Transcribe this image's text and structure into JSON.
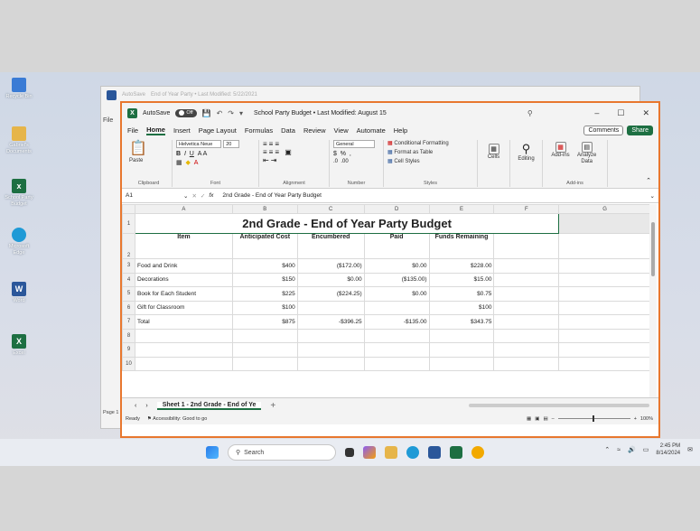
{
  "desktop_icons": [
    {
      "label": "Recycle Bin",
      "color": "#3a7bd5"
    },
    {
      "label": "Gabriel's Documents",
      "color": "#e6b54a"
    },
    {
      "label": "School Party Budget",
      "color": "#1d6f42"
    },
    {
      "label": "Microsoft Edge",
      "color": "#1f9ad6"
    },
    {
      "label": "Word",
      "color": "#2b579a"
    },
    {
      "label": "Excel",
      "color": "#1d6f42"
    }
  ],
  "back_window": {
    "title": "End of Year Party • Last Modified: 5/22/2021",
    "autosave": "AutoSave",
    "menu_file": "File",
    "page_label": "Page 1"
  },
  "window": {
    "autosave_label": "AutoSave",
    "autosave_state": "Off",
    "title": "School Party Budget • Last Modified: August 15"
  },
  "menu": {
    "items": [
      "File",
      "Home",
      "Insert",
      "Page Layout",
      "Formulas",
      "Data",
      "Review",
      "View",
      "Automate",
      "Help"
    ],
    "comments": "Comments",
    "share": "Share"
  },
  "ribbon": {
    "paste": "Paste",
    "clipboard": "Clipboard",
    "font_name": "Helvetica Neue",
    "font_size": "20",
    "font": "Font",
    "alignment": "Alignment",
    "number_format": "General",
    "number": "Number",
    "cond_format": "Conditional Formatting",
    "format_table": "Format as Table",
    "cell_styles": "Cell Styles",
    "styles": "Styles",
    "cells": "Cells",
    "editing": "Editing",
    "addins": "Add-ins",
    "analyze": "Analyze Data",
    "addins_group": "Add-ins"
  },
  "formula_bar": {
    "cell_ref": "A1",
    "fx": "fx",
    "content": "2nd Grade - End of Year Party Budget"
  },
  "columns": [
    "A",
    "B",
    "C",
    "D",
    "E",
    "F",
    "G"
  ],
  "sheet": {
    "title": "2nd Grade - End of Year Party Budget",
    "headers": [
      "Item",
      "Anticipated Cost",
      "Encumbered",
      "Paid",
      "Funds Remaining"
    ],
    "rows": [
      [
        "Food  and Drink",
        "$400",
        "($172.00)",
        "$0.00",
        "$228.00"
      ],
      [
        "Decorations",
        "$150",
        "$0.00",
        "($135.00)",
        "$15.00"
      ],
      [
        "Book for Each Student",
        "$225",
        "($224.25)",
        "$0.00",
        "$0.75"
      ],
      [
        "Gift for Classroom",
        "$100",
        "",
        "",
        "$100"
      ],
      [
        "Total",
        "$875",
        "-$396.25",
        "-$135.00",
        "$343.75"
      ]
    ],
    "row_numbers": [
      "1",
      "2",
      "3",
      "4",
      "5",
      "6",
      "7",
      "8",
      "9",
      "10"
    ]
  },
  "sheet_tab": "Sheet 1 - 2nd Grade - End of Ye",
  "status": {
    "ready": "Ready",
    "accessibility": "Accessibility: Good to go",
    "zoom": "100%"
  },
  "taskbar": {
    "search": "Search",
    "time": "2:45 PM",
    "date": "8/14/2024"
  }
}
